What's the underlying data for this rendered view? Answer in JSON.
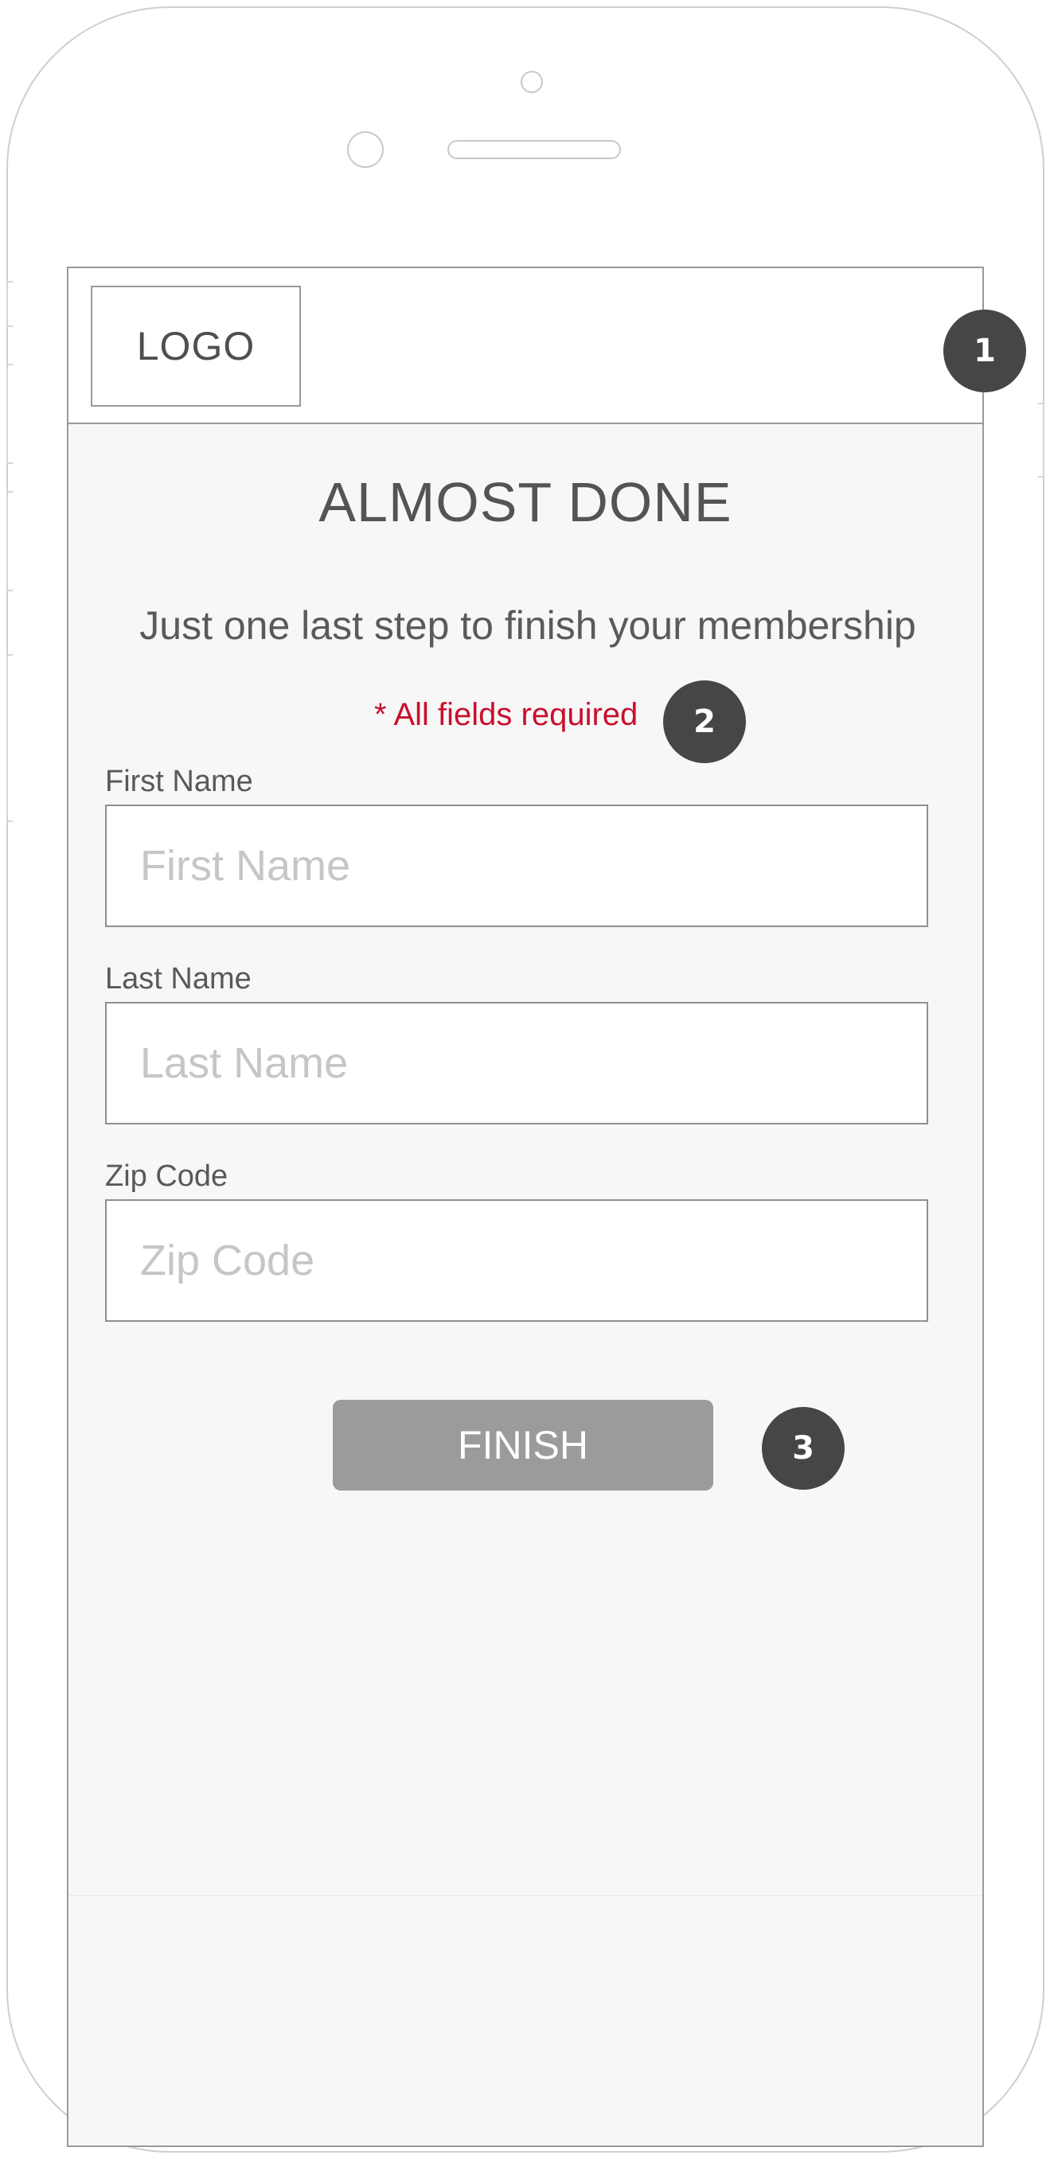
{
  "header": {
    "logo_text": "LOGO"
  },
  "main": {
    "title": "ALMOST DONE",
    "subtitle": "Just one last step to finish your membership",
    "required_note": "* All fields required"
  },
  "form": {
    "fields": [
      {
        "label": "First Name",
        "placeholder": "First Name",
        "value": ""
      },
      {
        "label": "Last Name",
        "placeholder": "Last Name",
        "value": ""
      },
      {
        "label": "Zip Code",
        "placeholder": "Zip Code",
        "value": ""
      }
    ],
    "submit_label": "FINISH"
  },
  "callouts": [
    "1",
    "2",
    "3"
  ],
  "colors": {
    "accent_required": "#c8102e",
    "button_background": "#9b9b9b",
    "callout_background": "#464646",
    "screen_background": "#f7f7f7"
  }
}
